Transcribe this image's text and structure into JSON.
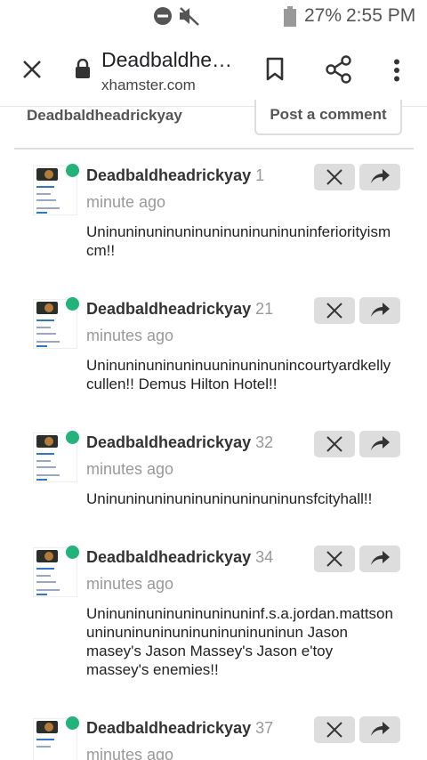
{
  "status_bar": {
    "battery": "27%",
    "time": "2:55 PM"
  },
  "browser": {
    "title": "Deadbaldhe…",
    "domain": "xhamster.com"
  },
  "header": {
    "username": "Deadbaldheadrickyay",
    "post_button": "Post a comment"
  },
  "comments": [
    {
      "author": "Deadbaldheadrickyay",
      "time": "1 minute ago",
      "text": "Uninuninuninuninuninuninuninuninferiorityismcm!!"
    },
    {
      "author": "Deadbaldheadrickyay",
      "time": "21 minutes ago",
      "text": "Uninuninuninuninuuninuninunincourtyardkellycullen!! Demus Hilton Hotel!!"
    },
    {
      "author": "Deadbaldheadrickyay",
      "time": "32 minutes ago",
      "text": "Uninuninuninuninuninuninuninunsfcityhall!!"
    },
    {
      "author": "Deadbaldheadrickyay",
      "time": "34 minutes ago",
      "text": "Uninuninuninuninuninuninf.s.a.jordan.mattson uninuninuninuninuninuninuninun Jason masey's Jason Massey's Jason e'toy massey's enemies!!"
    },
    {
      "author": "Deadbaldheadrickyay",
      "time": "37 minutes ago",
      "text": ""
    }
  ],
  "icons": {
    "close": "close-icon",
    "lock": "lock-icon",
    "bookmark": "bookmark-icon",
    "share": "share-icon",
    "menu": "more-vert-icon",
    "delete": "x-icon",
    "reply": "reply-arrow-icon"
  },
  "colors": {
    "online": "#22b37a",
    "action_bg": "#dddddd"
  }
}
